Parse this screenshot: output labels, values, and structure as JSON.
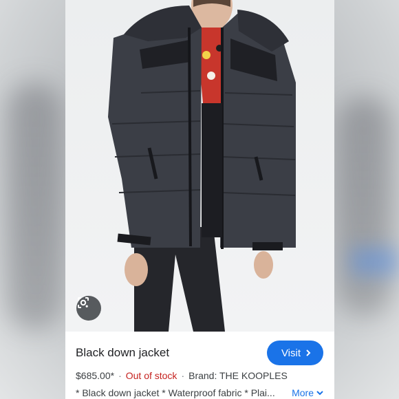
{
  "product": {
    "title": "Black down jacket",
    "price": "$685.00*",
    "availability": "Out of stock",
    "brand": "Brand: THE KOOPLES",
    "description": "* Black down jacket * Waterproof fabric * Plai...",
    "more_label": "More",
    "visit_label": "Visit",
    "separator": "·"
  },
  "icons": {
    "lens": "google-lens-icon",
    "visit_arrow": "chevron-right-icon",
    "more_arrow": "chevron-down-icon"
  },
  "colors": {
    "accent": "#1a73e8",
    "out_of_stock": "#c5221f",
    "text": "#202124"
  }
}
